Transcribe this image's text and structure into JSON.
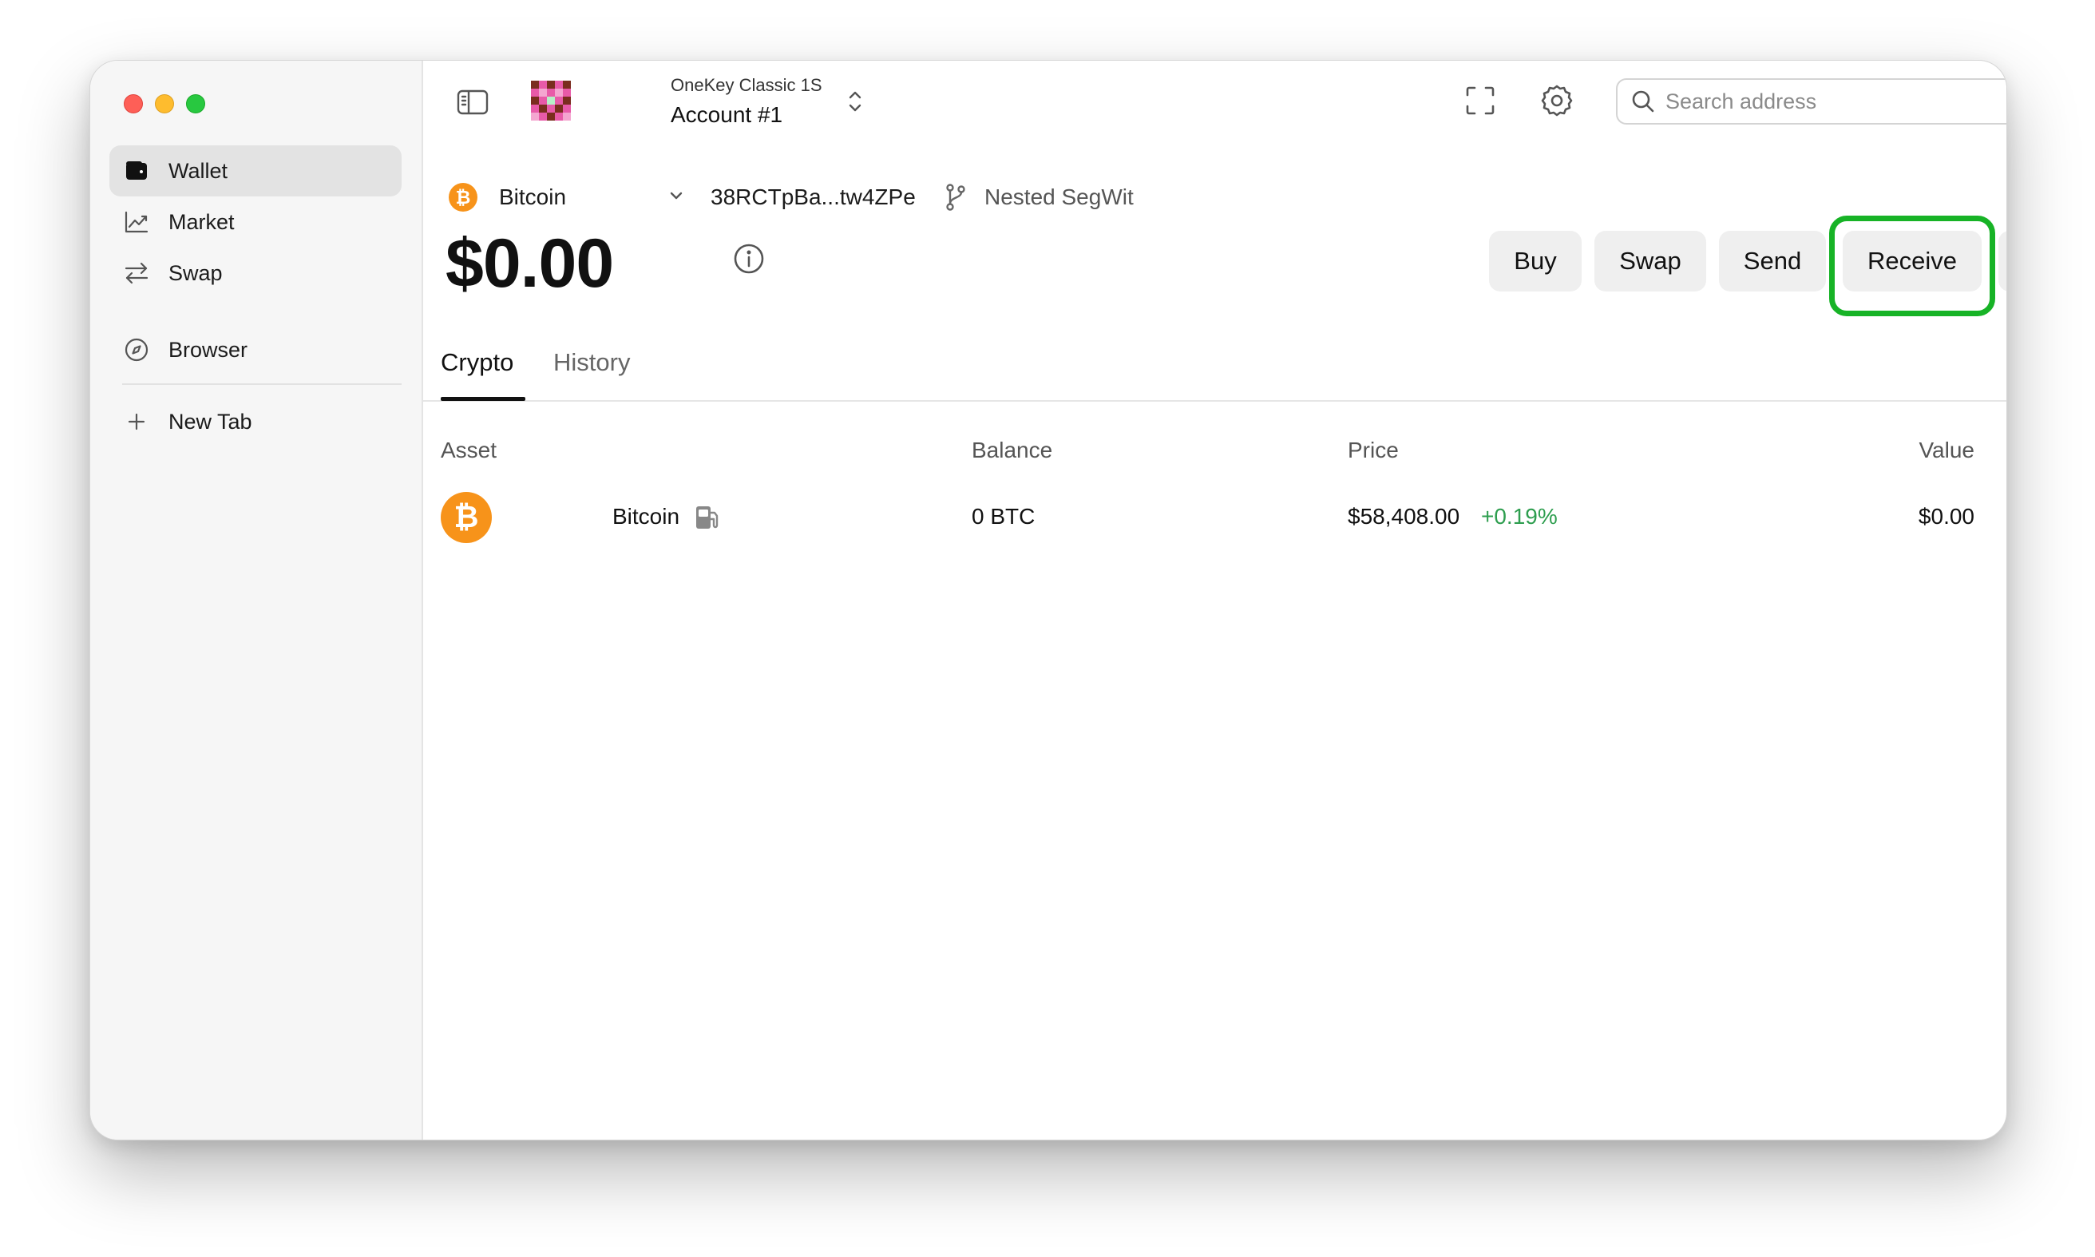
{
  "sidebar": {
    "items": [
      {
        "label": "Wallet",
        "icon": "wallet-icon",
        "active": true
      },
      {
        "label": "Market",
        "icon": "chart-line-icon",
        "active": false
      },
      {
        "label": "Swap",
        "icon": "arrows-swap-icon",
        "active": false
      },
      {
        "label": "Browser",
        "icon": "compass-icon",
        "active": false
      }
    ],
    "new_tab_label": "New Tab"
  },
  "header": {
    "device_name": "OneKey Classic 1S",
    "account_name": "Account #1",
    "search_placeholder": "Search address"
  },
  "account_info": {
    "network": "Bitcoin",
    "address": "38RCTpBa...tw4ZPe",
    "address_type": "Nested SegWit",
    "balance": "$0.00"
  },
  "actions": {
    "buy": "Buy",
    "swap": "Swap",
    "send": "Send",
    "receive": "Receive",
    "highlighted": "Receive"
  },
  "tabs": [
    {
      "label": "Crypto",
      "active": true
    },
    {
      "label": "History",
      "active": false
    }
  ],
  "table": {
    "headers": [
      "Asset",
      "Balance",
      "Price",
      "Value"
    ],
    "rows": [
      {
        "asset": "Bitcoin",
        "balance": "0 BTC",
        "price": "$58,408.00",
        "change": "+0.19%",
        "value": "$0.00"
      }
    ]
  },
  "colors": {
    "accent_bitcoin": "#f7931a",
    "positive_change": "#2e9e4f",
    "highlight_border": "#17b326"
  }
}
